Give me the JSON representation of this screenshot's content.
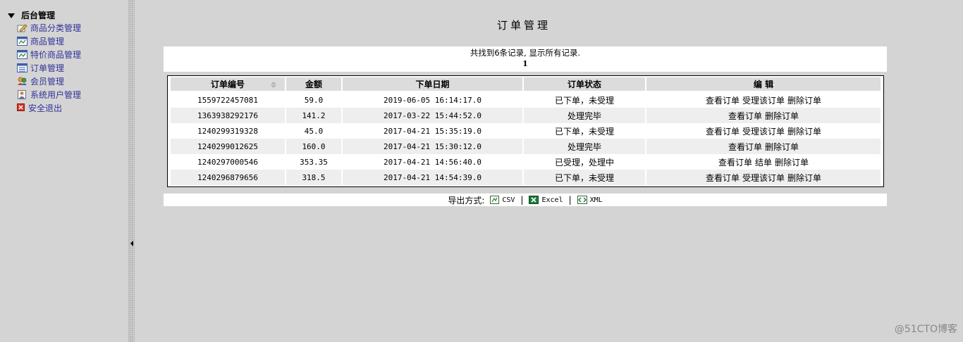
{
  "sidebar": {
    "root_label": "后台管理",
    "items": [
      {
        "label": "商品分类管理",
        "icon": "pencil-icon"
      },
      {
        "label": "商品管理",
        "icon": "window-icon"
      },
      {
        "label": "特价商品管理",
        "icon": "window-icon"
      },
      {
        "label": "订单管理",
        "icon": "list-icon"
      },
      {
        "label": "会员管理",
        "icon": "members-icon"
      },
      {
        "label": "系统用户管理",
        "icon": "user-icon"
      },
      {
        "label": "安全退出",
        "icon": "exit-icon"
      }
    ]
  },
  "main": {
    "title": "订单管理",
    "summary": "共找到6条记录, 显示所有记录.",
    "page": "1",
    "columns": [
      "订单编号",
      "金额",
      "下单日期",
      "订单状态",
      "编 辑"
    ],
    "rows": [
      {
        "id": "1559722457081",
        "amount": "59.0",
        "date": "2019-06-05 16:14:17.0",
        "status": "已下单，未受理",
        "actions": [
          "查看订单",
          "受理该订单",
          "删除订单"
        ]
      },
      {
        "id": "1363938292176",
        "amount": "141.2",
        "date": "2017-03-22 15:44:52.0",
        "status": "处理完毕",
        "actions": [
          "查看订单",
          "删除订单"
        ]
      },
      {
        "id": "1240299319328",
        "amount": "45.0",
        "date": "2017-04-21 15:35:19.0",
        "status": "已下单，未受理",
        "actions": [
          "查看订单",
          "受理该订单",
          "删除订单"
        ]
      },
      {
        "id": "1240299012625",
        "amount": "160.0",
        "date": "2017-04-21 15:30:12.0",
        "status": "处理完毕",
        "actions": [
          "查看订单",
          "删除订单"
        ]
      },
      {
        "id": "1240297000546",
        "amount": "353.35",
        "date": "2017-04-21 14:56:40.0",
        "status": "已受理，处理中",
        "actions": [
          "查看订单",
          "结单",
          "删除订单"
        ]
      },
      {
        "id": "1240296879656",
        "amount": "318.5",
        "date": "2017-04-21 14:54:39.0",
        "status": "已下单，未受理",
        "actions": [
          "查看订单",
          "受理该订单",
          "删除订单"
        ]
      }
    ],
    "export": {
      "label": "导出方式:",
      "options": [
        "CSV",
        "Excel",
        "XML"
      ],
      "separator": "|"
    }
  },
  "watermark": "@51CTO博客",
  "colors": {
    "nav_link": "#33329a",
    "background": "#d4d4d4",
    "header_bg": "#dcdcdc",
    "row_alt": "#eeeeee"
  }
}
